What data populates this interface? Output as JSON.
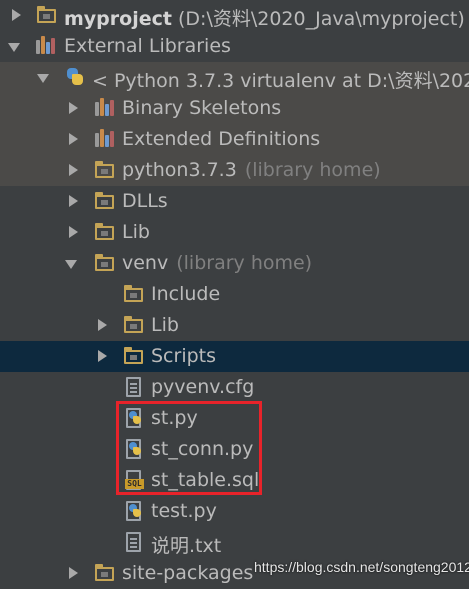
{
  "tree": {
    "project": {
      "name": "myproject",
      "path": "(D:\\资料\\2020_Java\\myproject)"
    },
    "external_libraries": {
      "label": "External Libraries"
    },
    "sdk": {
      "label": "< Python 3.7.3 virtualenv at D:\\资料\\202"
    },
    "binary_skeletons": {
      "label": "Binary Skeletons"
    },
    "extended_definitions": {
      "label": "Extended Definitions"
    },
    "python373": {
      "label": "python3.7.3",
      "hint": "(library home)"
    },
    "dlls": {
      "label": "DLLs"
    },
    "lib": {
      "label": "Lib"
    },
    "venv": {
      "label": "venv",
      "hint": "(library home)"
    },
    "include": {
      "label": "Include"
    },
    "venv_lib": {
      "label": "Lib"
    },
    "scripts": {
      "label": "Scripts"
    },
    "pyvenv": {
      "label": "pyvenv.cfg"
    },
    "st_py": {
      "label": "st.py"
    },
    "st_conn": {
      "label": "st_conn.py"
    },
    "st_table": {
      "label": "st_table.sql"
    },
    "test_py": {
      "label": "test.py"
    },
    "readme": {
      "label": "说明.txt"
    },
    "site_packages": {
      "label": "site-packages"
    }
  },
  "watermark": "https://blog.csdn.net/songteng2012",
  "icons": {
    "sql_badge": "SQL"
  },
  "colors": {
    "background": "#3c3f41",
    "row_alt": "#4b4a48",
    "selected": "#0d293e",
    "highlight_box": "#e8232a",
    "folder": "#c4a456"
  }
}
